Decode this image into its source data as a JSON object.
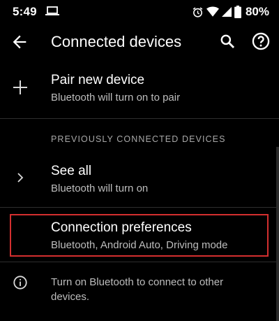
{
  "status_bar": {
    "time": "5:49",
    "battery": "80%",
    "icons": [
      "laptop-icon",
      "alarm-icon",
      "wifi-icon",
      "signal-icon",
      "battery-icon"
    ]
  },
  "app_bar": {
    "title": "Connected devices",
    "icons": [
      "back-arrow-icon",
      "search-icon",
      "help-icon"
    ]
  },
  "pair_new_device": {
    "title": "Pair new device",
    "subtitle": "Bluetooth will turn on to pair",
    "icon": "plus-icon"
  },
  "previously_connected": {
    "header": "PREVIOUSLY CONNECTED DEVICES",
    "see_all": {
      "title": "See all",
      "subtitle": "Bluetooth will turn on",
      "icon": "chevron-right-icon"
    }
  },
  "connection_preferences": {
    "title": "Connection preferences",
    "subtitle": "Bluetooth, Android Auto, Driving mode",
    "highlight_color": "#d32f2f"
  },
  "info": {
    "text": "Turn on Bluetooth to connect to other devices.",
    "icon": "info-icon"
  },
  "colors": {
    "background": "#000000",
    "primary_text": "#ffffff",
    "secondary_text": "#bdbdbd",
    "highlight": "#d32f2f"
  }
}
